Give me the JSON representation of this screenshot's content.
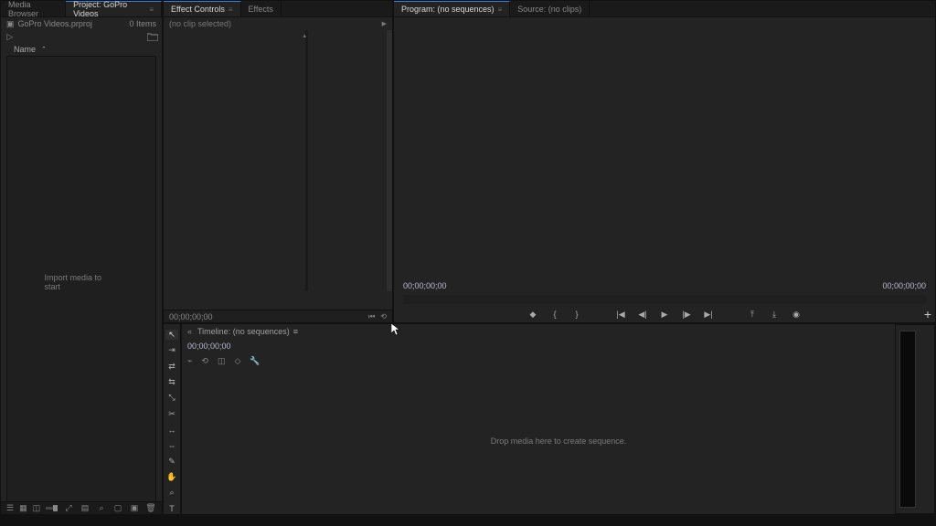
{
  "project_panel": {
    "tabs": {
      "media_browser": "Media Browser",
      "project": "Project: GoPro Videos"
    },
    "file_row": {
      "filename": "GoPro Videos.prproj",
      "item_count": "0 Items"
    },
    "columns": {
      "name": "Name"
    },
    "empty_message": "Import media to start"
  },
  "effect_controls_panel": {
    "tabs": {
      "effect_controls": "Effect Controls",
      "effects": "Effects"
    },
    "subheader": "(no clip selected)",
    "timecode": "00;00;00;00"
  },
  "program_panel": {
    "tabs": {
      "program": "Program: (no sequences)",
      "source": "Source: (no clips)"
    },
    "timecode_left": "00;00;00;00",
    "timecode_right": "00;00;00;00"
  },
  "timeline_panel": {
    "tabs": {
      "timeline": "Timeline: (no sequences)"
    },
    "timecode": "00;00;00;00",
    "empty_message": "Drop media here to create sequence."
  },
  "tools": [
    "selection-tool",
    "track-select-forward-tool",
    "ripple-edit-tool",
    "rolling-edit-tool",
    "rate-stretch-tool",
    "razor-tool",
    "slip-tool",
    "slide-tool",
    "pen-tool",
    "hand-tool",
    "zoom-tool",
    "type-tool"
  ],
  "timeline_options": [
    "snap",
    "linked-selection",
    "add-marker",
    "timeline-settings",
    "wrench"
  ],
  "program_controls": [
    "add-marker",
    "mark-in",
    "mark-out",
    "go-to-in",
    "step-back",
    "play",
    "step-forward",
    "go-to-out",
    "lift",
    "extract",
    "export-frame"
  ],
  "project_bottom": [
    "list-view",
    "icon-view",
    "freeform-view"
  ]
}
